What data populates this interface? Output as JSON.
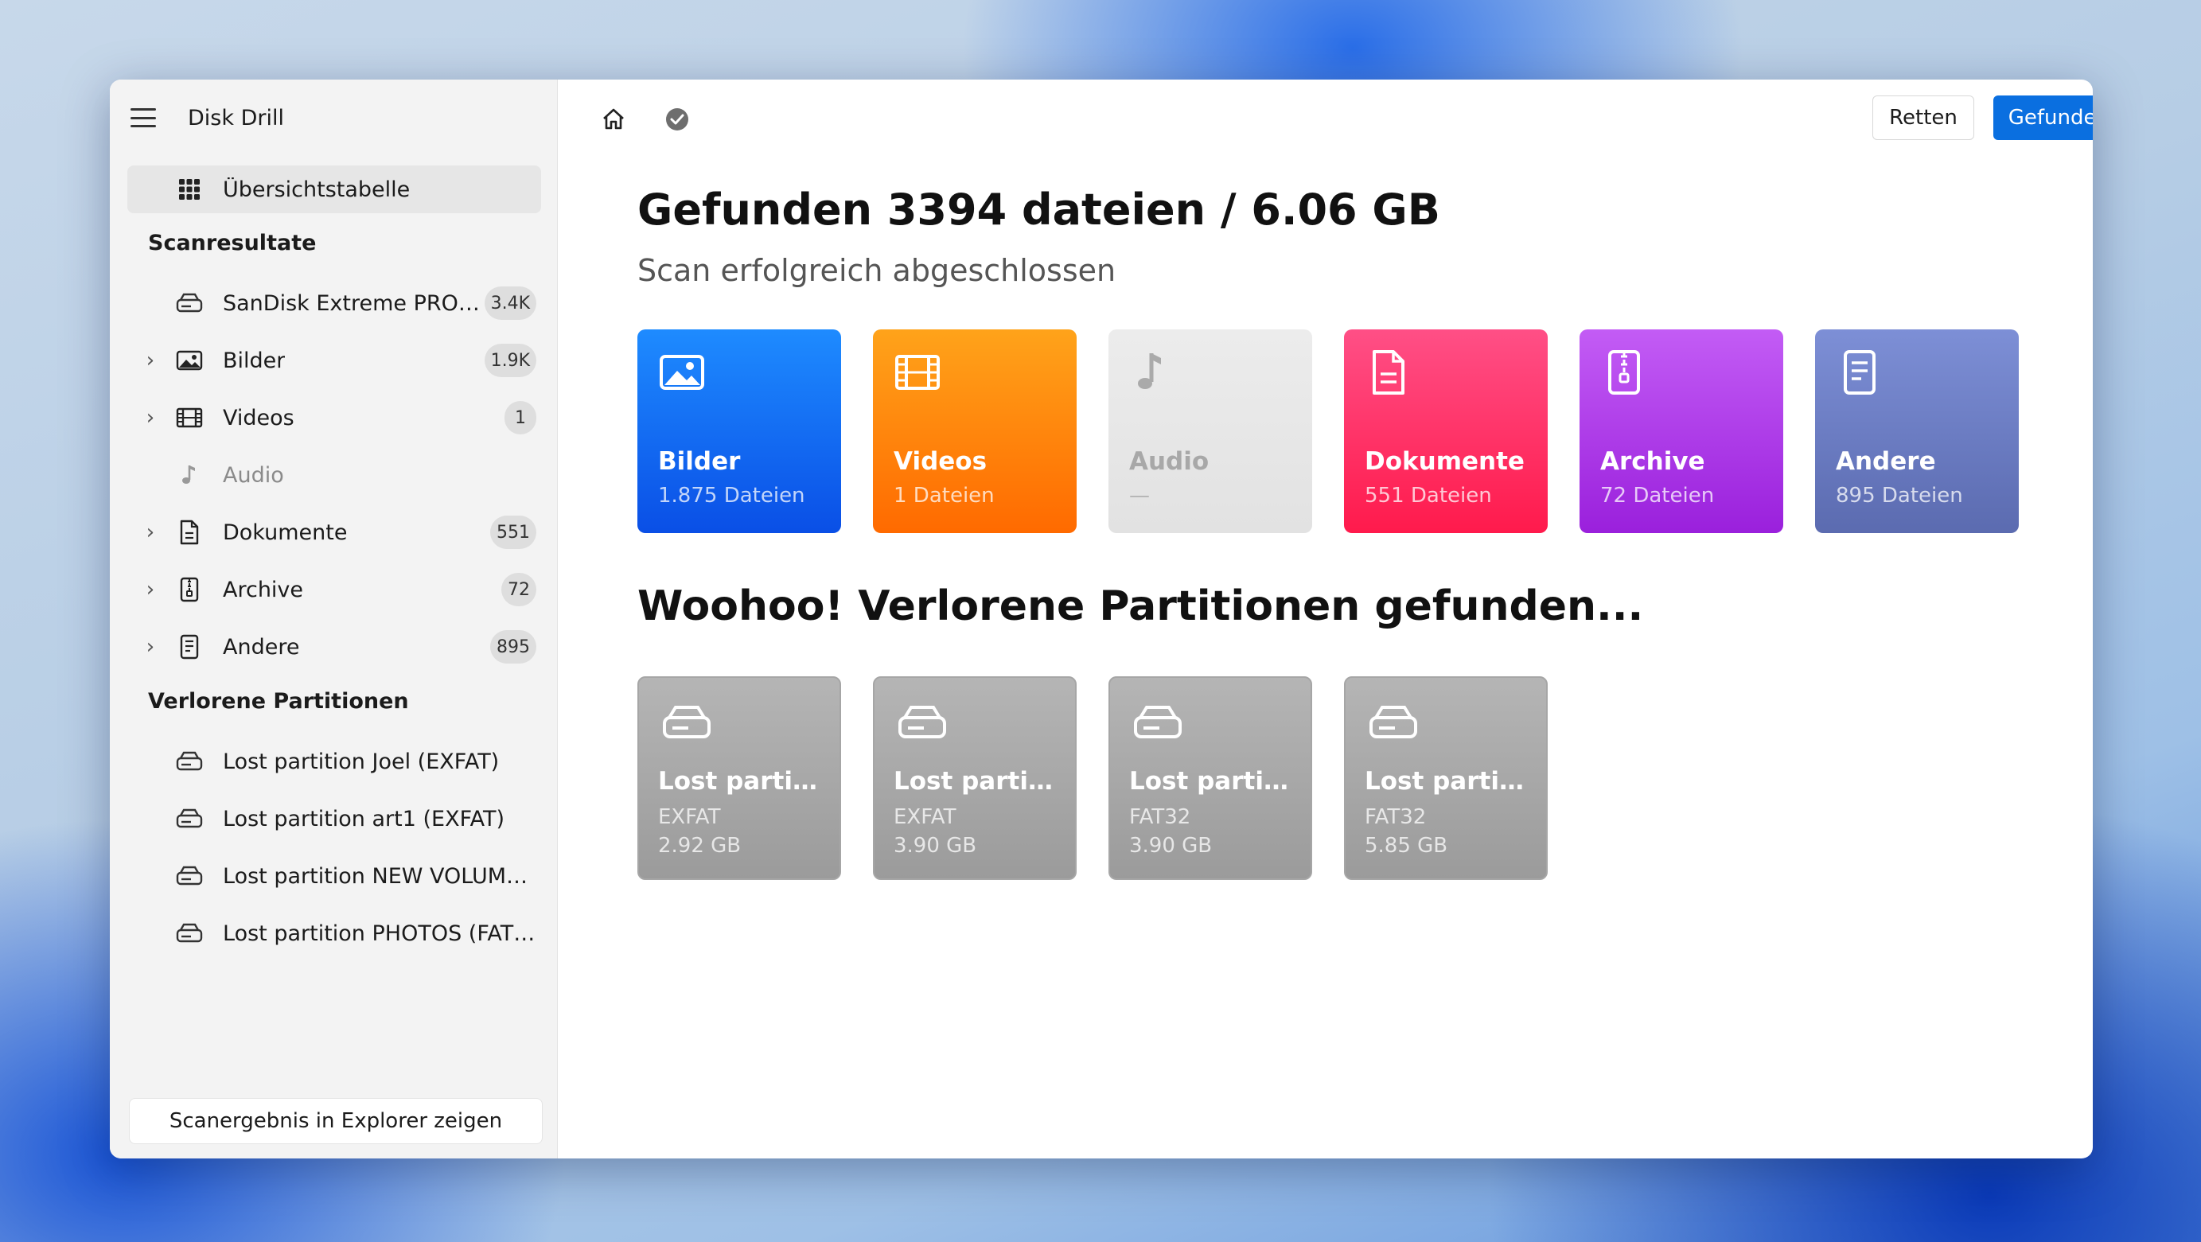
{
  "app": {
    "title": "Disk Drill"
  },
  "sidebar": {
    "overview": "Übersichtstabelle",
    "scan_results_heading": "Scanresultate",
    "scan_items": [
      {
        "label": "SanDisk Extreme PRO R...",
        "count": "3.4K",
        "icon": "drive-icon"
      },
      {
        "label": "Bilder",
        "count": "1.9K",
        "icon": "image-icon"
      },
      {
        "label": "Videos",
        "count": "1",
        "icon": "film-icon"
      },
      {
        "label": "Audio",
        "count": "",
        "icon": "music-note-icon"
      },
      {
        "label": "Dokumente",
        "count": "551",
        "icon": "document-icon"
      },
      {
        "label": "Archive",
        "count": "72",
        "icon": "archive-icon"
      },
      {
        "label": "Andere",
        "count": "895",
        "icon": "other-file-icon"
      }
    ],
    "lost_partitions_heading": "Verlorene Partitionen",
    "lost_items": [
      {
        "label": "Lost partition Joel (EXFAT)"
      },
      {
        "label": "Lost partition art1 (EXFAT)"
      },
      {
        "label": "Lost partition NEW VOLUME (..."
      },
      {
        "label": "Lost partition PHOTOS (FAT32)"
      }
    ],
    "footer_button": "Scanergebnis in Explorer zeigen"
  },
  "toolbar": {
    "retten": "Retten",
    "review": "Gefundene Objekte prüfen"
  },
  "main": {
    "title": "Gefunden 3394 dateien / 6.06 GB",
    "subtitle": "Scan erfolgreich abgeschlossen",
    "categories": [
      {
        "name": "Bilder",
        "sub": "1.875 Dateien",
        "color_from": "#1e8bff",
        "color_to": "#0a4fe6"
      },
      {
        "name": "Videos",
        "sub": "1 Dateien",
        "color_from": "#ffa31a",
        "color_to": "#ff6a00"
      },
      {
        "name": "Audio",
        "sub": "—",
        "color_from": "#ececec",
        "color_to": "#e2e2e2"
      },
      {
        "name": "Dokumente",
        "sub": "551 Dateien",
        "color_from": "#ff4f86",
        "color_to": "#ff1a4c"
      },
      {
        "name": "Archive",
        "sub": "72 Dateien",
        "color_from": "#c35cf5",
        "color_to": "#9a20dc"
      },
      {
        "name": "Andere",
        "sub": "895 Dateien",
        "color_from": "#7d8fd6",
        "color_to": "#5b6bb0"
      }
    ],
    "partitions_heading": "Woohoo! Verlorene Partitionen gefunden...",
    "partitions": [
      {
        "name": "Lost partitio...",
        "fs": "EXFAT",
        "size": "2.92 GB"
      },
      {
        "name": "Lost partitio...",
        "fs": "EXFAT",
        "size": "3.90 GB"
      },
      {
        "name": "Lost partitio...",
        "fs": "FAT32",
        "size": "3.90 GB"
      },
      {
        "name": "Lost partitio...",
        "fs": "FAT32",
        "size": "5.85 GB"
      }
    ]
  }
}
